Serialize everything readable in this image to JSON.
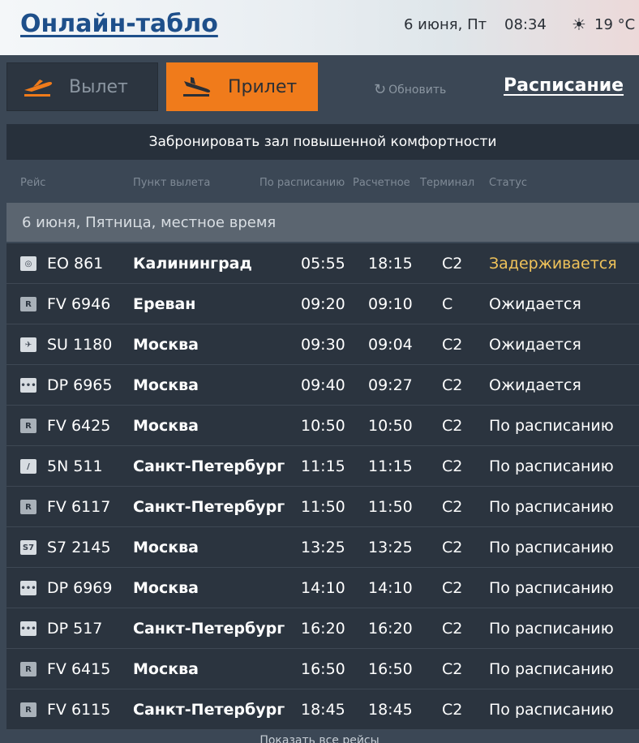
{
  "header": {
    "title": "Онлайн-табло",
    "date": "6 июня, Пт",
    "time": "08:34",
    "weather_icon": "sun-icon",
    "temperature": "19 °C"
  },
  "tabs": {
    "departure": {
      "label": "Вылет",
      "icon": "plane-takeoff-icon"
    },
    "arrival": {
      "label": "Прилет",
      "icon": "plane-landing-icon"
    }
  },
  "refresh_label": "Обновить",
  "schedule_label": "Расписание",
  "book_banner": "Забронировать зал повышенной комфортности",
  "columns": {
    "flight": "Рейс",
    "origin": "Пункт вылета",
    "scheduled": "По расписанию",
    "estimated": "Расчетное",
    "terminal": "Терминал",
    "status": "Статус"
  },
  "date_heading": "6 июня, Пятница, местное время",
  "flights": [
    {
      "logo": "◎",
      "flight": "EO 861",
      "city": "Калининград",
      "scheduled": "05:55",
      "estimated": "18:15",
      "terminal": "C2",
      "status": "Задерживается",
      "delayed": true
    },
    {
      "logo": "R",
      "flight": "FV 6946",
      "city": "Ереван",
      "scheduled": "09:20",
      "estimated": "09:10",
      "terminal": "C",
      "status": "Ожидается",
      "delayed": false
    },
    {
      "logo": "✈",
      "flight": "SU 1180",
      "city": "Москва",
      "scheduled": "09:30",
      "estimated": "09:04",
      "terminal": "C2",
      "status": "Ожидается",
      "delayed": false
    },
    {
      "logo": "•••",
      "flight": "DP 6965",
      "city": "Москва",
      "scheduled": "09:40",
      "estimated": "09:27",
      "terminal": "C2",
      "status": "Ожидается",
      "delayed": false
    },
    {
      "logo": "R",
      "flight": "FV 6425",
      "city": "Москва",
      "scheduled": "10:50",
      "estimated": "10:50",
      "terminal": "C2",
      "status": "По расписанию",
      "delayed": false
    },
    {
      "logo": "/",
      "flight": "5N 511",
      "city": "Санкт-Петербург",
      "scheduled": "11:15",
      "estimated": "11:15",
      "terminal": "C2",
      "status": "По расписанию",
      "delayed": false
    },
    {
      "logo": "R",
      "flight": "FV 6117",
      "city": "Санкт-Петербург",
      "scheduled": "11:50",
      "estimated": "11:50",
      "terminal": "C2",
      "status": "По расписанию",
      "delayed": false
    },
    {
      "logo": "S7",
      "flight": "S7 2145",
      "city": "Москва",
      "scheduled": "13:25",
      "estimated": "13:25",
      "terminal": "C2",
      "status": "По расписанию",
      "delayed": false
    },
    {
      "logo": "•••",
      "flight": "DP 6969",
      "city": "Москва",
      "scheduled": "14:10",
      "estimated": "14:10",
      "terminal": "C2",
      "status": "По расписанию",
      "delayed": false
    },
    {
      "logo": "•••",
      "flight": "DP 517",
      "city": "Санкт-Петербург",
      "scheduled": "16:20",
      "estimated": "16:20",
      "terminal": "C2",
      "status": "По расписанию",
      "delayed": false
    },
    {
      "logo": "R",
      "flight": "FV 6415",
      "city": "Москва",
      "scheduled": "16:50",
      "estimated": "16:50",
      "terminal": "C2",
      "status": "По расписанию",
      "delayed": false
    },
    {
      "logo": "R",
      "flight": "FV 6115",
      "city": "Санкт-Петербург",
      "scheduled": "18:45",
      "estimated": "18:45",
      "terminal": "C2",
      "status": "По расписанию",
      "delayed": false
    }
  ],
  "footer_link": "Показать все рейсы",
  "colors": {
    "accent": "#f07b1b",
    "delayed": "#f0c35a",
    "title": "#1e4f8a"
  }
}
